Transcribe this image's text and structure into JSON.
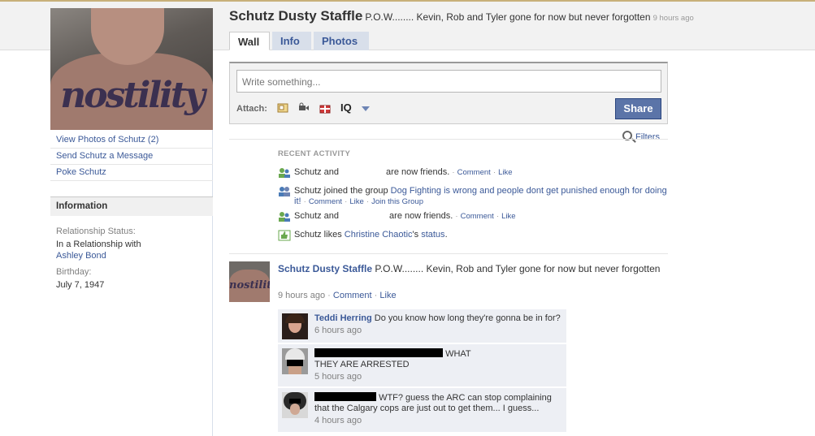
{
  "profile": {
    "name": "Schutz Dusty Staffle",
    "status": "P.O.W........ Kevin, Rob and Tyler gone for now but never forgotten",
    "status_time": "9 hours ago",
    "tattoo_text": "nostility"
  },
  "left_links": [
    "View Photos of Schutz (2)",
    "Send Schutz a Message",
    "Poke Schutz"
  ],
  "info": {
    "heading": "Information",
    "relationship_label": "Relationship Status:",
    "relationship_value": "In a Relationship with",
    "relationship_partner": "Ashley Bond",
    "birthday_label": "Birthday:",
    "birthday_value": "July 7, 1947"
  },
  "tabs": [
    "Wall",
    "Info",
    "Photos"
  ],
  "publisher": {
    "placeholder": "Write something...",
    "attach_label": "Attach:",
    "iq_label": "IQ",
    "share_label": "Share"
  },
  "filters_label": "Filters",
  "recent": {
    "title": "RECENT ACTIVITY",
    "items": [
      {
        "who": "Schutz and",
        "rest": "are now friends.",
        "comment": "Comment",
        "like": "Like"
      },
      {
        "who": "Schutz joined the group",
        "group": "Dog Fighting is wrong and people dont get punished enough for doing it!",
        "comment": "Comment",
        "like": "Like",
        "join": "Join this Group"
      },
      {
        "who": "Schutz and",
        "rest": "are now friends.",
        "comment": "Comment",
        "like": "Like"
      },
      {
        "who": "Schutz likes",
        "target": "Christine Chaotic",
        "suffix": "'s",
        "status": "status",
        "end": "."
      }
    ]
  },
  "post": {
    "author": "Schutz Dusty Staffle",
    "text": "P.O.W........ Kevin, Rob and Tyler gone for now but never forgotten",
    "time": "9 hours ago",
    "comment": "Comment",
    "like": "Like"
  },
  "comments": [
    {
      "author": "Teddi Herring",
      "text": "Do you know how long they're gonna be in for?",
      "time": "6 hours ago"
    },
    {
      "author": "",
      "text1": "WHAT",
      "text2": "THEY ARE ARRESTED",
      "time": "5 hours ago"
    },
    {
      "author": "",
      "text": "WTF? guess the ARC can stop complaining that the Calgary cops are just out to get them... I guess...",
      "time": "4 hours ago"
    }
  ],
  "colors": {
    "link": "#3b5998",
    "share_button": "#5b74a8",
    "comment_bg": "#edeff4"
  }
}
